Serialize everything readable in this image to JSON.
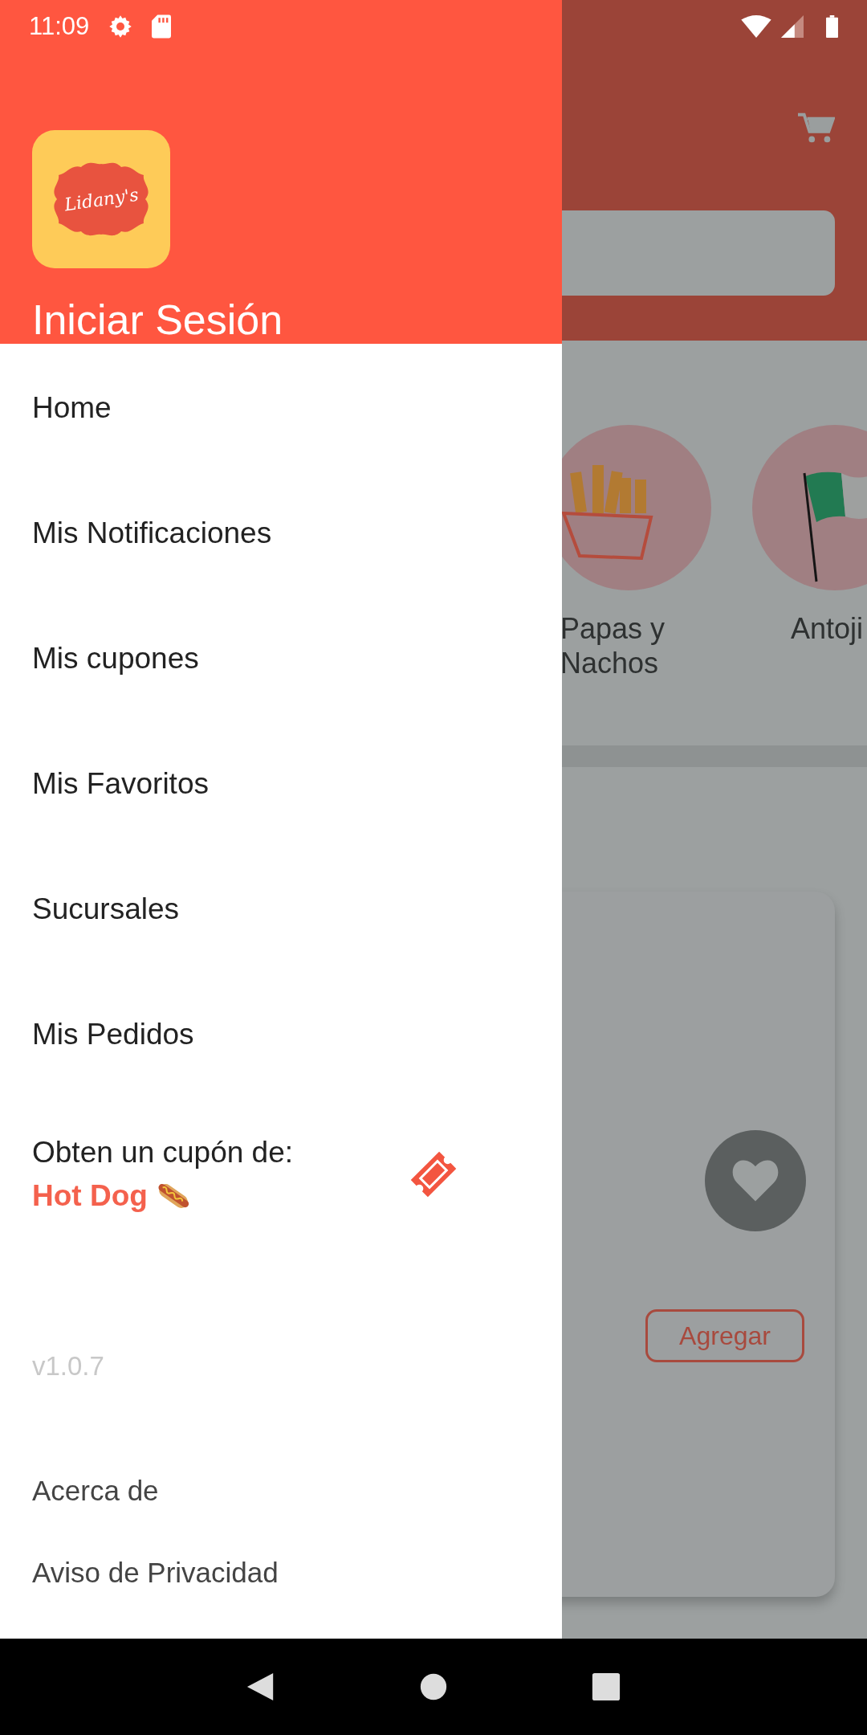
{
  "status_bar": {
    "time": "11:09"
  },
  "background": {
    "categories": [
      {
        "label": "Papas y Nachos",
        "kind": "fries"
      },
      {
        "label": "Antoji",
        "kind": "flag"
      }
    ],
    "product_card": {
      "add_button": "Agregar"
    }
  },
  "drawer": {
    "logo_text": "Lidany's",
    "login_label": "Iniciar Sesión",
    "menu_items": [
      "Home",
      "Mis Notificaciones",
      "Mis cupones",
      "Mis Favoritos",
      "Sucursales",
      "Mis Pedidos"
    ],
    "coupon": {
      "prompt": "Obten un cupón de:",
      "product": "Hot Dog"
    },
    "version": "v1.0.7",
    "footer_links": [
      "Acerca de",
      "Aviso de Privacidad"
    ]
  }
}
